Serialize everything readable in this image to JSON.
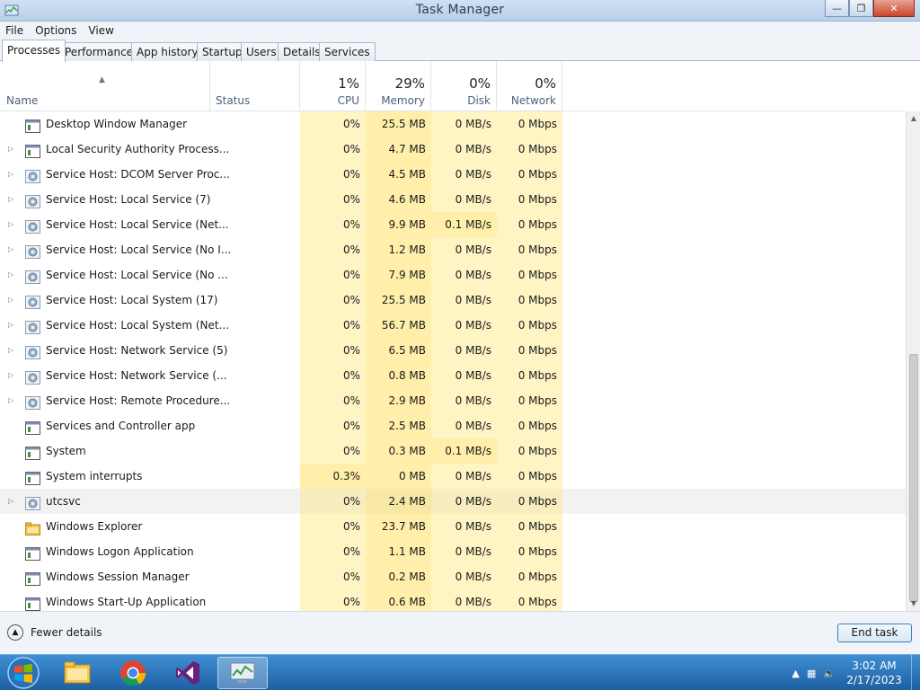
{
  "window": {
    "title": "Task Manager"
  },
  "menu": [
    "File",
    "Options",
    "View"
  ],
  "tabs": [
    "Processes",
    "Performance",
    "App history",
    "Startup",
    "Users",
    "Details",
    "Services"
  ],
  "columns": {
    "name": "Name",
    "status": "Status",
    "cpu": {
      "pct": "1%",
      "label": "CPU"
    },
    "memory": {
      "pct": "29%",
      "label": "Memory"
    },
    "disk": {
      "pct": "0%",
      "label": "Disk"
    },
    "network": {
      "pct": "0%",
      "label": "Network"
    }
  },
  "processes": [
    {
      "name": "Desktop Window Manager",
      "cpu": "0%",
      "memory": "25.5 MB",
      "disk": "0 MB/s",
      "network": "0 Mbps",
      "expandable": false,
      "icon": "window-app-icon"
    },
    {
      "name": "Local Security Authority Process...",
      "cpu": "0%",
      "memory": "4.7 MB",
      "disk": "0 MB/s",
      "network": "0 Mbps",
      "expandable": true,
      "icon": "window-app-icon"
    },
    {
      "name": "Service Host: DCOM Server Proc...",
      "cpu": "0%",
      "memory": "4.5 MB",
      "disk": "0 MB/s",
      "network": "0 Mbps",
      "expandable": true,
      "icon": "gear-icon"
    },
    {
      "name": "Service Host: Local Service (7)",
      "cpu": "0%",
      "memory": "4.6 MB",
      "disk": "0 MB/s",
      "network": "0 Mbps",
      "expandable": true,
      "icon": "gear-icon"
    },
    {
      "name": "Service Host: Local Service (Net...",
      "cpu": "0%",
      "memory": "9.9 MB",
      "disk": "0.1 MB/s",
      "network": "0 Mbps",
      "expandable": true,
      "icon": "gear-icon"
    },
    {
      "name": "Service Host: Local Service (No I...",
      "cpu": "0%",
      "memory": "1.2 MB",
      "disk": "0 MB/s",
      "network": "0 Mbps",
      "expandable": true,
      "icon": "gear-icon"
    },
    {
      "name": "Service Host: Local Service (No ...",
      "cpu": "0%",
      "memory": "7.9 MB",
      "disk": "0 MB/s",
      "network": "0 Mbps",
      "expandable": true,
      "icon": "gear-icon"
    },
    {
      "name": "Service Host: Local System (17)",
      "cpu": "0%",
      "memory": "25.5 MB",
      "disk": "0 MB/s",
      "network": "0 Mbps",
      "expandable": true,
      "icon": "gear-icon"
    },
    {
      "name": "Service Host: Local System (Net...",
      "cpu": "0%",
      "memory": "56.7 MB",
      "disk": "0 MB/s",
      "network": "0 Mbps",
      "expandable": true,
      "icon": "gear-icon"
    },
    {
      "name": "Service Host: Network Service (5)",
      "cpu": "0%",
      "memory": "6.5 MB",
      "disk": "0 MB/s",
      "network": "0 Mbps",
      "expandable": true,
      "icon": "gear-icon"
    },
    {
      "name": "Service Host: Network Service (...",
      "cpu": "0%",
      "memory": "0.8 MB",
      "disk": "0 MB/s",
      "network": "0 Mbps",
      "expandable": true,
      "icon": "gear-icon"
    },
    {
      "name": "Service Host: Remote Procedure...",
      "cpu": "0%",
      "memory": "2.9 MB",
      "disk": "0 MB/s",
      "network": "0 Mbps",
      "expandable": true,
      "icon": "gear-icon"
    },
    {
      "name": "Services and Controller app",
      "cpu": "0%",
      "memory": "2.5 MB",
      "disk": "0 MB/s",
      "network": "0 Mbps",
      "expandable": false,
      "icon": "window-app-icon"
    },
    {
      "name": "System",
      "cpu": "0%",
      "memory": "0.3 MB",
      "disk": "0.1 MB/s",
      "network": "0 Mbps",
      "expandable": false,
      "icon": "window-app-icon"
    },
    {
      "name": "System interrupts",
      "cpu": "0.3%",
      "memory": "0 MB",
      "disk": "0 MB/s",
      "network": "0 Mbps",
      "expandable": false,
      "icon": "window-app-icon"
    },
    {
      "name": "utcsvc",
      "cpu": "0%",
      "memory": "2.4 MB",
      "disk": "0 MB/s",
      "network": "0 Mbps",
      "expandable": true,
      "icon": "gear-icon",
      "highlighted": true
    },
    {
      "name": "Windows Explorer",
      "cpu": "0%",
      "memory": "23.7 MB",
      "disk": "0 MB/s",
      "network": "0 Mbps",
      "expandable": false,
      "icon": "folder-icon"
    },
    {
      "name": "Windows Logon Application",
      "cpu": "0%",
      "memory": "1.1 MB",
      "disk": "0 MB/s",
      "network": "0 Mbps",
      "expandable": false,
      "icon": "window-app-icon"
    },
    {
      "name": "Windows Session Manager",
      "cpu": "0%",
      "memory": "0.2 MB",
      "disk": "0 MB/s",
      "network": "0 Mbps",
      "expandable": false,
      "icon": "window-app-icon"
    },
    {
      "name": "Windows Start-Up Application",
      "cpu": "0%",
      "memory": "0.6 MB",
      "disk": "0 MB/s",
      "network": "0 Mbps",
      "expandable": false,
      "icon": "window-app-icon"
    }
  ],
  "footer": {
    "fewer_details": "Fewer details",
    "end_task": "End task"
  },
  "taskbar": {
    "items": [
      "file-explorer-icon",
      "chrome-icon",
      "visual-studio-icon",
      "task-manager-icon"
    ],
    "clock_time": "3:02 AM",
    "clock_date": "2/17/2023"
  }
}
